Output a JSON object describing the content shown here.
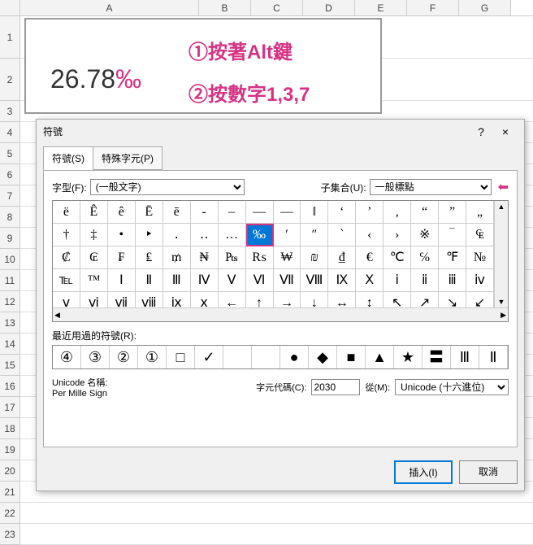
{
  "sheet": {
    "columns": [
      "A",
      "B",
      "C",
      "D",
      "E",
      "F",
      "G"
    ],
    "row_numbers": [
      1,
      2,
      3,
      4,
      5,
      6,
      7,
      8,
      9,
      10,
      11,
      12,
      13,
      14,
      15,
      16,
      17,
      18,
      19,
      20,
      21,
      22,
      23
    ],
    "big_number": "26.78",
    "big_symbol": "‰",
    "annotation1": "①按著Alt鍵",
    "annotation2": "②按數字1,3,7"
  },
  "dialog": {
    "title": "符號",
    "help": "?",
    "close": "×",
    "tabs": {
      "symbols": "符號(S)",
      "special": "特殊字元(P)"
    },
    "font_label": "字型(F):",
    "font_value": "(一般文字)",
    "subset_label": "子集合(U):",
    "subset_value": "一般標點",
    "symbols": [
      [
        "ë",
        "Ê",
        "ê",
        "Ē",
        "ē",
        "‐",
        "–",
        "—",
        "―",
        "‖",
        "‘",
        "’",
        "‚",
        "“",
        "”",
        "„"
      ],
      [
        "†",
        "‡",
        "•",
        "‣",
        "․",
        "‥",
        "…",
        "‰",
        "′",
        "″",
        "‵",
        "‹",
        "›",
        "※",
        "‾",
        "₠"
      ],
      [
        "₡",
        "₢",
        "₣",
        "₤",
        "₥",
        "₦",
        "₧",
        "₨",
        "₩",
        "₪",
        "₫",
        "€",
        "℃",
        "℅",
        "℉",
        "№"
      ],
      [
        "℡",
        "™",
        "Ⅰ",
        "Ⅱ",
        "Ⅲ",
        "Ⅳ",
        "Ⅴ",
        "Ⅵ",
        "Ⅶ",
        "Ⅷ",
        "Ⅸ",
        "Ⅹ",
        "ⅰ",
        "ⅱ",
        "ⅲ",
        "ⅳ"
      ],
      [
        "ⅴ",
        "ⅵ",
        "ⅶ",
        "ⅷ",
        "ⅸ",
        "ⅹ",
        "←",
        "↑",
        "→",
        "↓",
        "↔",
        "↕",
        "↖",
        "↗",
        "↘",
        "↙"
      ]
    ],
    "selected_symbol": "‰",
    "recent_label": "最近用過的符號(R):",
    "recent": [
      "④",
      "③",
      "②",
      "①",
      "□",
      "✓",
      "",
      "",
      "●",
      "◆",
      "■",
      "▲",
      "★",
      "〓",
      "Ⅲ",
      "Ⅱ"
    ],
    "unicode_name_label": "Unicode 名稱:",
    "unicode_name": "Per Mille Sign",
    "char_code_label": "字元代碼(C):",
    "char_code": "2030",
    "from_label": "從(M):",
    "from_value": "Unicode (十六進位)",
    "insert_btn": "插入(I)",
    "cancel_btn": "取消"
  }
}
